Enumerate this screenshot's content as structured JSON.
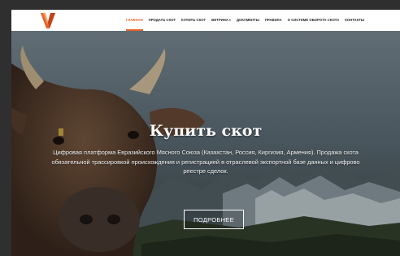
{
  "brand": {
    "logo_icon": "v-letter-logo-icon",
    "accent": "#e8622c"
  },
  "nav": {
    "items": [
      {
        "label": "ГЛАВНАЯ",
        "active": true
      },
      {
        "label": "ПРОДАТЬ СКОТ"
      },
      {
        "label": "КУПИТЬ СКОТ"
      },
      {
        "label": "ВИТРИНА",
        "dropdown": true
      },
      {
        "label": "ДОКУМЕНТЫ"
      },
      {
        "label": "ПРАВИЛА"
      },
      {
        "label": "О СИСТЕМЕ ОБОРОТА СКОТА"
      },
      {
        "label": "КОНТАКТЫ"
      }
    ],
    "caret": "▾"
  },
  "hero": {
    "title": "Купить скот",
    "description_line1": "Цифровая платформа Евразийского Мясного Союза (Казахстан, Россия, Киргизия, Армения). Продажа скота",
    "description_line2": "обязательной трассировкой происхождения и регистрацией в отраслевой экспортной базе данных и цифрово",
    "description_line3": "реестре сделок.",
    "button_label": "ПОДРОБНЕЕ"
  }
}
